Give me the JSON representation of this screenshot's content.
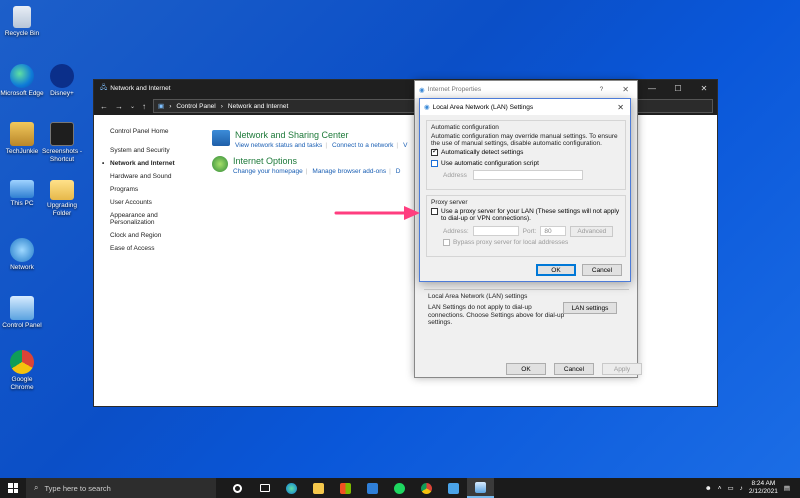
{
  "desktop": {
    "icons": [
      {
        "label": "Recycle Bin"
      },
      {
        "label": "Microsoft Edge"
      },
      {
        "label": "Disney+"
      },
      {
        "label": "TechJunkie"
      },
      {
        "label": "Screenshots - Shortcut"
      },
      {
        "label": "This PC"
      },
      {
        "label": "Upgrading Folder"
      },
      {
        "label": "Network"
      },
      {
        "label": "Control Panel"
      },
      {
        "label": "Google Chrome"
      }
    ]
  },
  "control_panel": {
    "title": "Network and Internet",
    "breadcrumb": [
      "Control Panel",
      "Network and Internet"
    ],
    "sidebar": [
      "Control Panel Home",
      "System and Security",
      "Network and Internet",
      "Hardware and Sound",
      "Programs",
      "User Accounts",
      "Appearance and Personalization",
      "Clock and Region",
      "Ease of Access"
    ],
    "sections": [
      {
        "heading": "Network and Sharing Center",
        "links": [
          "View network status and tasks",
          "Connect to a network",
          "V"
        ]
      },
      {
        "heading": "Internet Options",
        "links": [
          "Change your homepage",
          "Manage browser add-ons",
          "D"
        ]
      }
    ]
  },
  "internet_properties": {
    "title": "Internet Properties",
    "help_glyph": "?",
    "lan_group_title": "Local Area Network (LAN) settings",
    "lan_group_text": "LAN Settings do not apply to dial-up connections. Choose Settings above for dial-up settings.",
    "lan_settings_button": "LAN settings",
    "ok": "OK",
    "cancel": "Cancel",
    "apply": "Apply"
  },
  "lan_dialog": {
    "title": "Local Area Network (LAN) Settings",
    "auto_group_title": "Automatic configuration",
    "auto_desc": "Automatic configuration may override manual settings. To ensure the use of manual settings, disable automatic configuration.",
    "auto_detect_label": "Automatically detect settings",
    "auto_detect_checked": true,
    "use_script_label": "Use automatic configuration script",
    "use_script_checked": false,
    "script_address_label": "Address",
    "proxy_group_title": "Proxy server",
    "use_proxy_label": "Use a proxy server for your LAN (These settings will not apply to dial-up or VPN connections).",
    "use_proxy_checked": false,
    "proxy_address_label": "Address:",
    "proxy_port_label": "Port:",
    "proxy_port_value": "80",
    "advanced_button": "Advanced",
    "bypass_label": "Bypass proxy server for local addresses",
    "ok": "OK",
    "cancel": "Cancel"
  },
  "taskbar": {
    "search_placeholder": "Type here to search",
    "time": "8:24 AM",
    "date": "2/12/2021"
  },
  "colors": {
    "arrow": "#ff3d7f",
    "link": "#1a5fb4",
    "heading_green": "#1e7a3a",
    "desktop_blue": "#0b4fc7"
  }
}
